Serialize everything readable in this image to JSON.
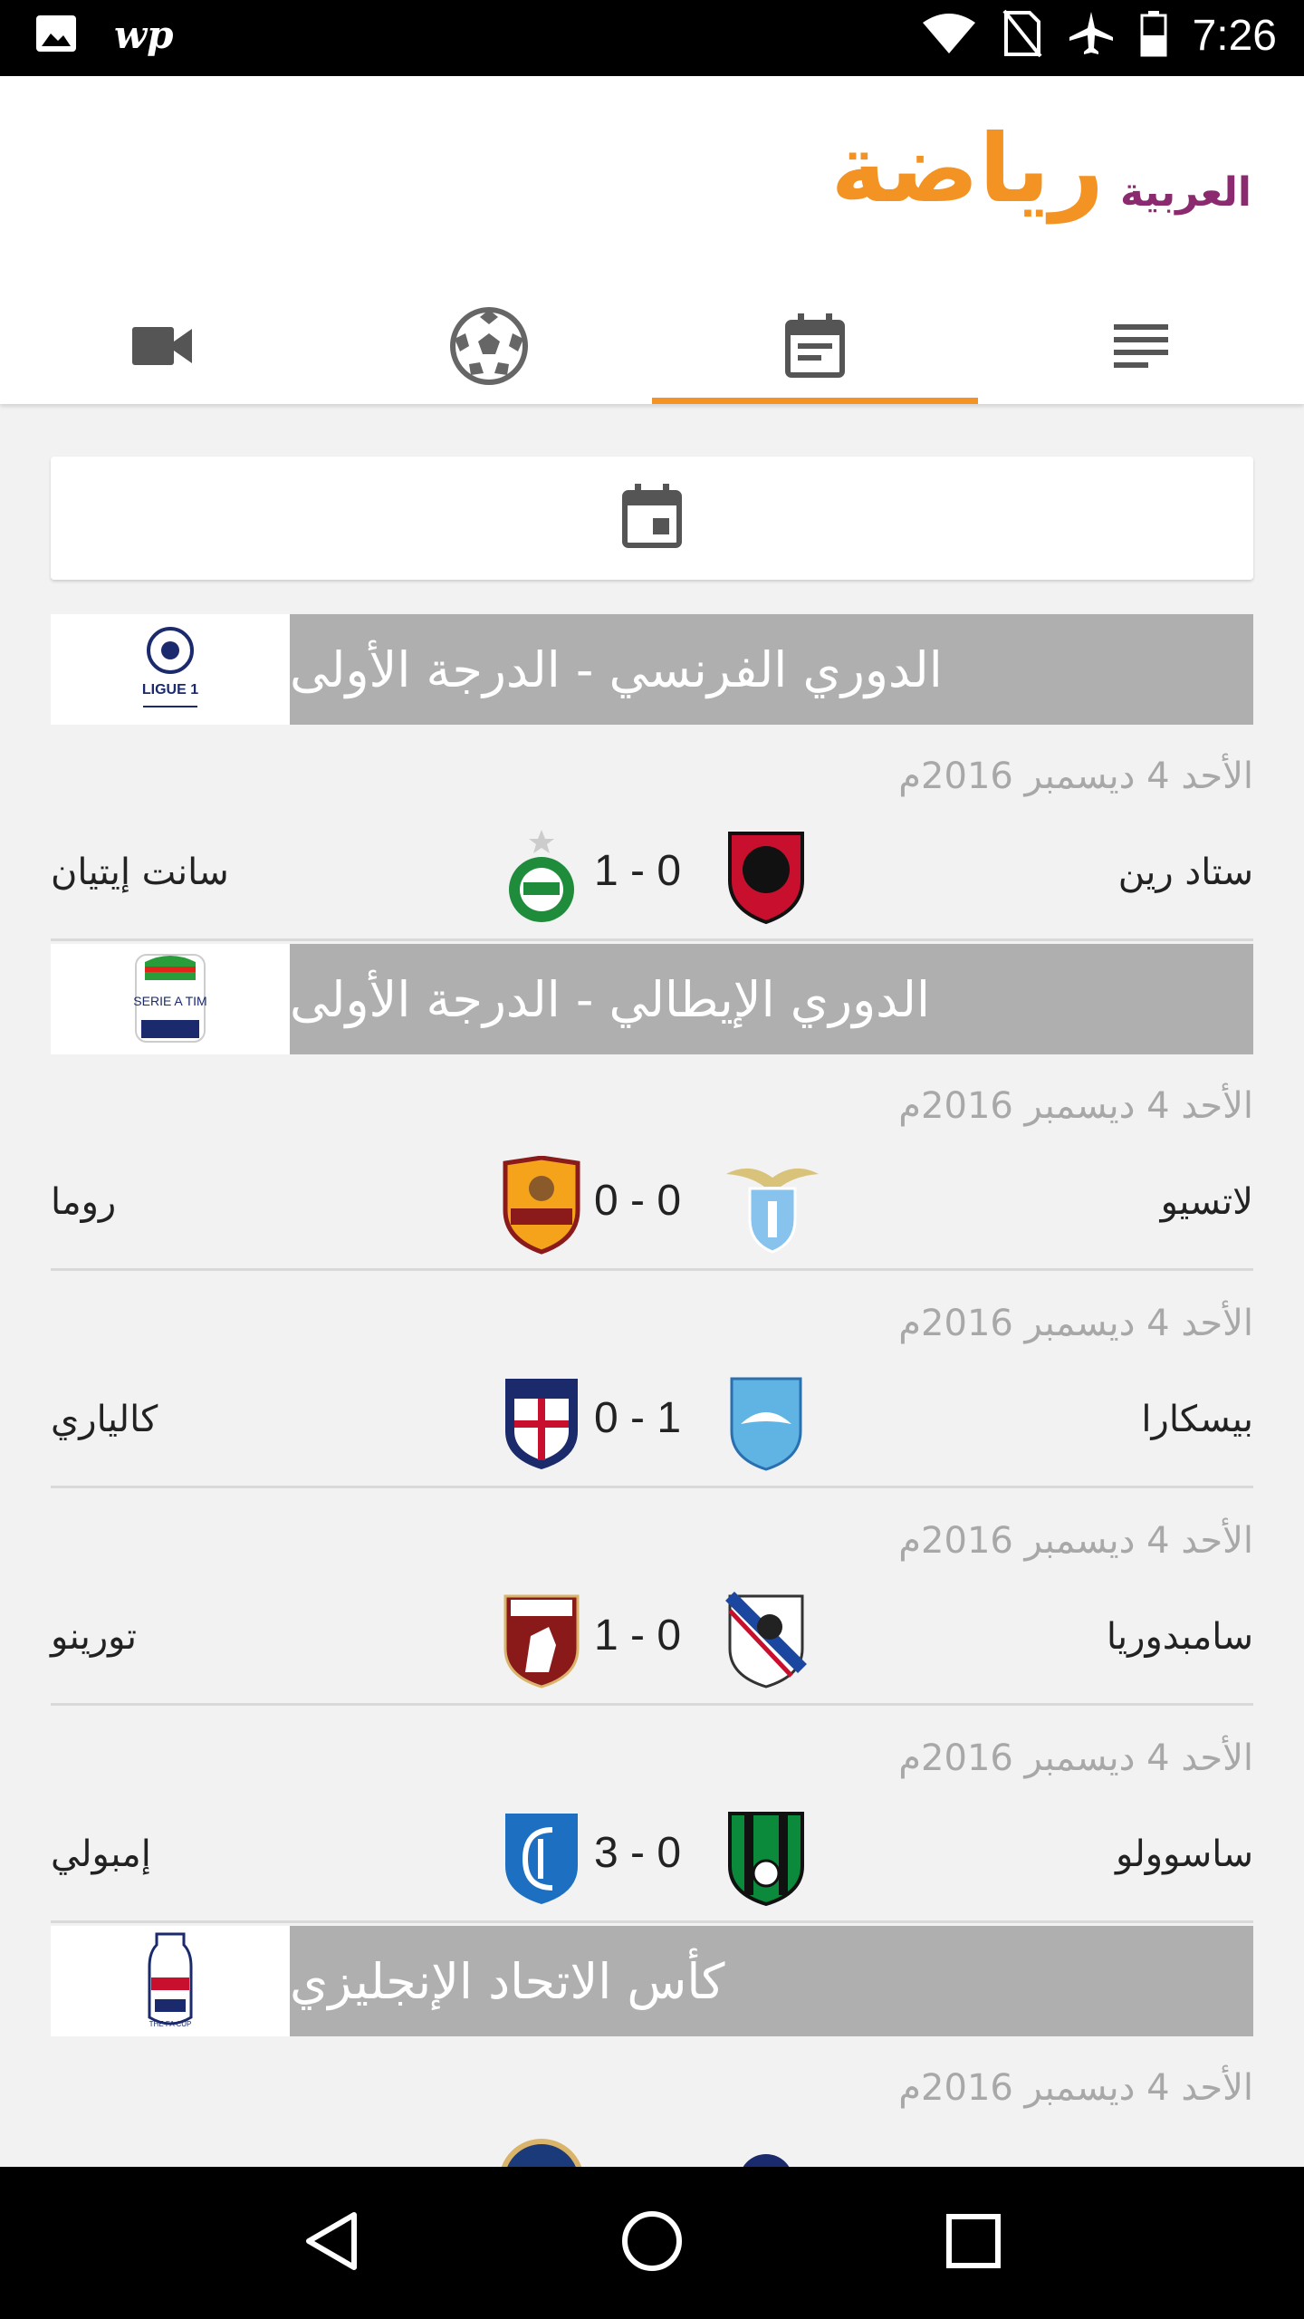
{
  "status_bar": {
    "time": "7:26",
    "wp_label": "wp"
  },
  "app": {
    "logo_brand": "العربية",
    "logo_word": "رياضة"
  },
  "tabs": [
    {
      "icon": "video-icon"
    },
    {
      "icon": "football-icon"
    },
    {
      "icon": "calendar-icon"
    },
    {
      "icon": "news-list-icon"
    }
  ],
  "leagues": [
    {
      "name": "الدوري الفرنسي - الدرجة الأولى",
      "logo_text": "LIGUE 1"
    },
    {
      "name": "الدوري الإيطالي - الدرجة الأولى",
      "logo_text": "SERIE A TIM"
    },
    {
      "name": "كأس الاتحاد الإنجليزي",
      "logo_text": "THE FA CUP"
    }
  ],
  "matches": [
    {
      "date": "الأحد 4 ديسمبر 2016م",
      "home": "ستاد رين",
      "away": "سانت إيتيان",
      "score": "1 - 0",
      "home_color": "#c8102e",
      "away_color": "#1e8c3a"
    },
    {
      "date": "الأحد 4 ديسمبر 2016م",
      "home": "لاتسيو",
      "away": "روما",
      "score": "0 - 0",
      "home_color": "#87c3ec",
      "away_color": "#c8102e"
    },
    {
      "date": "الأحد 4 ديسمبر 2016م",
      "home": "بيسكارا",
      "away": "كالياري",
      "score": "0 - 1",
      "home_color": "#5fb4e4",
      "away_color": "#1b2a6b"
    },
    {
      "date": "الأحد 4 ديسمبر 2016م",
      "home": "سامبدوريا",
      "away": "تورينو",
      "score": "1 - 0",
      "home_color": "#1c47a0",
      "away_color": "#8a1a1a"
    },
    {
      "date": "الأحد 4 ديسمبر 2016م",
      "home": "ساسوولو",
      "away": "إمبولي",
      "score": "3 - 0",
      "home_color": "#0a8a3a",
      "away_color": "#1d6fc2"
    }
  ],
  "last_date": "الأحد 4 ديسمبر 2016م"
}
